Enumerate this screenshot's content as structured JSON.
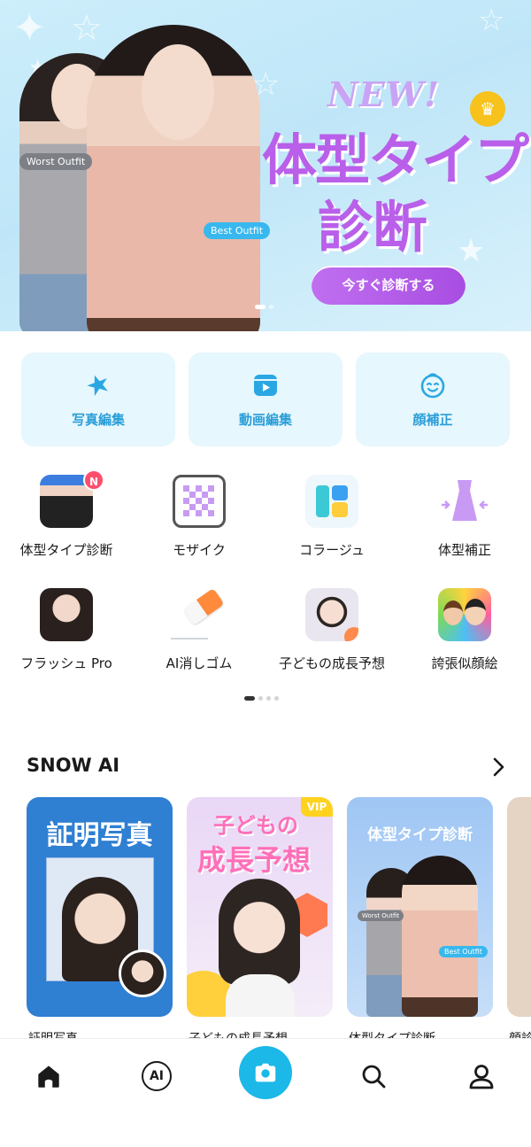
{
  "hero": {
    "tag_worst": "Worst Outfit",
    "tag_best": "Best Outfit",
    "new_label": "NEW!",
    "title_line1": "体型タイプ",
    "title_line2": "診断",
    "cta_label": "今すぐ診断する",
    "slide_index": 1,
    "slide_count": 2
  },
  "big_tools": [
    {
      "label": "写真編集",
      "icon": "photo-edit-icon"
    },
    {
      "label": "動画編集",
      "icon": "video-edit-icon"
    },
    {
      "label": "顔補正",
      "icon": "face-icon"
    }
  ],
  "features": [
    {
      "label": "体型タイプ診断",
      "badge": "N"
    },
    {
      "label": "モザイク"
    },
    {
      "label": "コラージュ"
    },
    {
      "label": "体型補正"
    },
    {
      "label": "フラッシュ Pro"
    },
    {
      "label": "AI消しゴム"
    },
    {
      "label": "子どもの成長予想"
    },
    {
      "label": "誇張似顔絵"
    }
  ],
  "snow_ai": {
    "title": "SNOW AI",
    "cards": [
      {
        "title": "証明写真",
        "caption": "証明写真"
      },
      {
        "title_line1": "子どもの",
        "title_line2": "成長予想",
        "badge": "VIP",
        "caption": "子どもの成長予想"
      },
      {
        "title": "体型タイプ診断",
        "tag_worst": "Worst Outfit",
        "tag_best": "Best Outfit",
        "caption": "体型タイプ診断"
      },
      {
        "caption": "顔診"
      }
    ]
  },
  "nav": {
    "items": [
      "home-icon",
      "ai-icon",
      "camera-icon",
      "search-icon",
      "profile-icon"
    ],
    "ai_label": "AI"
  },
  "colors": {
    "accent": "#1bb8e8",
    "purple": "#b95fe9",
    "tool_bg": "#e6f7fd",
    "tool_text": "#2a9ed8"
  }
}
